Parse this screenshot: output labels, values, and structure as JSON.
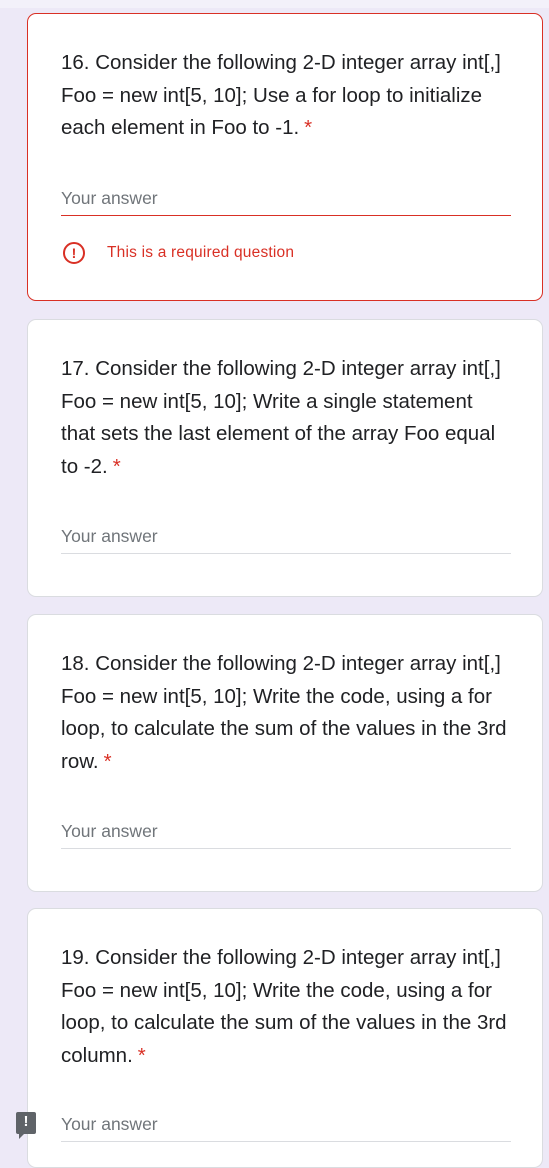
{
  "questions": [
    {
      "text": "16. Consider the following 2-D integer array int[,] Foo = new int[5, 10]; Use a for loop to initialize each element in Foo to -1.",
      "required_mark": "*",
      "answer_placeholder": "Your answer",
      "error_text": "This is a required question"
    },
    {
      "text": "17. Consider the following 2-D integer array int[,] Foo = new int[5, 10]; Write a single statement that sets the last element of the array Foo equal to -2.",
      "required_mark": "*",
      "answer_placeholder": "Your answer"
    },
    {
      "text": "18. Consider the following 2-D integer array int[,] Foo = new int[5, 10]; Write the code, using a for loop, to calculate the sum of the values in the 3rd row.",
      "required_mark": "*",
      "answer_placeholder": "Your answer"
    },
    {
      "text": "19. Consider the following 2-D integer array int[,] Foo = new int[5, 10]; Write the code, using a for loop, to calculate the sum of the values in the 3rd column.",
      "required_mark": "*",
      "answer_placeholder": "Your answer"
    }
  ],
  "error_icon_glyph": "!",
  "feedback_icon_glyph": "!",
  "colors": {
    "page_background": "#ede9f7",
    "error": "#d93025",
    "text": "#202124",
    "placeholder": "#70757a"
  }
}
